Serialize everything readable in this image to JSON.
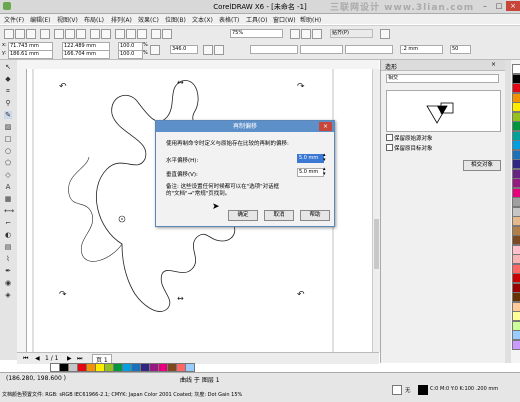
{
  "window": {
    "title": "CorelDRAW X6 - [未命名 -1]",
    "watermark": "三联网设计 www.3lian.com"
  },
  "menu": [
    "文件(F)",
    "编辑(E)",
    "视图(V)",
    "布局(L)",
    "排列(A)",
    "效果(C)",
    "位图(B)",
    "文本(X)",
    "表格(T)",
    "工具(O)",
    "窗口(W)",
    "帮助(H)"
  ],
  "toolbar": {
    "zoom": "75%",
    "snap": "贴齐(P)"
  },
  "propbar": {
    "x": "71.743 mm",
    "y": "186.61 mm",
    "w": "122.489 mm",
    "h": "166.704 mm",
    "sx": "100.0",
    "sy": "100.0",
    "pct": "%",
    "angle": "346.0",
    "outline": ".2 mm",
    "size": "50"
  },
  "docker": {
    "title": "造形",
    "dropdown": "相交",
    "opt_source": "保留原始源对象",
    "opt_target": "保留原目标对象",
    "button": "相交对象"
  },
  "dialog": {
    "title": "再制偏移",
    "desc": "使用再制命令时定义与原始存在比较的再制的偏移:",
    "h_label": "水平偏移(H):",
    "h_value": "5.0 mm",
    "v_label": "垂直偏移(V):",
    "v_value": "5.0 mm",
    "note": "备注: 这些设置任何时候都可以在\"选项\"对话框的\"文档\"→\"常规\"页找到。",
    "ok": "确定",
    "cancel": "取消",
    "help": "帮助"
  },
  "pagebar": {
    "pages": "1 / 1",
    "tab": "页 1"
  },
  "status": {
    "coords": "(186.280, 198.600 )",
    "object": "曲线 于 图层 1",
    "profile": "文档颜色预置文件: RGB: sRGB IEC61966-2.1; CMYK: Japan Color 2001 Coated; 灰度: Dot Gain 15%",
    "fill": "无",
    "outline_info": "C:0 M:0 Y:0 K:100 .200 mm"
  },
  "palette_colors": [
    "#ffffff",
    "#000000",
    "#e30613",
    "#f39200",
    "#ffed00",
    "#95c11f",
    "#009640",
    "#00a19a",
    "#009fe3",
    "#1d71b8",
    "#312783",
    "#662483",
    "#951b81",
    "#e6007e",
    "#a0a0a0",
    "#c6c6c6",
    "#e5b98e",
    "#b17f4a",
    "#7b4a21",
    "#ffc0cb",
    "#f8b4b4",
    "#ff6666",
    "#cc0000",
    "#990000",
    "#663300",
    "#ffcc99",
    "#ffff99",
    "#ccff99",
    "#99ccff",
    "#cc99ff"
  ],
  "hpalette_colors": [
    "#ffffff",
    "#000000",
    "#c6c6c6",
    "#e30613",
    "#f39200",
    "#ffed00",
    "#95c11f",
    "#009640",
    "#009fe3",
    "#1d71b8",
    "#312783",
    "#951b81",
    "#e6007e",
    "#7b4a21",
    "#ff6666",
    "#99ccff"
  ]
}
